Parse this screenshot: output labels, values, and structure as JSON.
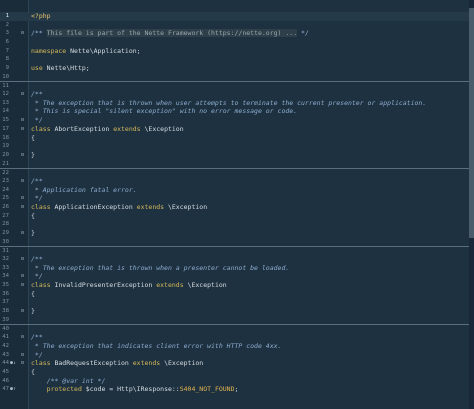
{
  "editor": {
    "lines": [
      {
        "n": "1",
        "tokens": [
          {
            "t": "<?php",
            "c": "tk-php"
          }
        ],
        "current": true
      },
      {
        "n": "2",
        "tokens": []
      },
      {
        "n": "3",
        "fold": "⊟",
        "tokens": [
          {
            "t": "/** ",
            "c": "tk-comment-plain"
          },
          {
            "t": "This file is part of the Nette Framework (https://nette.org) ...",
            "c": "hl"
          },
          {
            "t": " */",
            "c": "tk-comment-plain"
          }
        ]
      },
      {
        "n": "6",
        "tokens": []
      },
      {
        "n": "7",
        "tokens": [
          {
            "t": "namespace ",
            "c": "tk-keyword"
          },
          {
            "t": "Nette\\Application;",
            "c": "tk-text"
          }
        ]
      },
      {
        "n": "8",
        "tokens": []
      },
      {
        "n": "9",
        "tokens": [
          {
            "t": "use ",
            "c": "tk-keyword"
          },
          {
            "t": "Nette\\Http;",
            "c": "tk-text"
          }
        ]
      },
      {
        "n": "10",
        "tokens": []
      },
      {
        "n": "11",
        "tokens": [],
        "sep": true
      },
      {
        "n": "12",
        "fold": "⊟",
        "tokens": [
          {
            "t": "/**",
            "c": "tk-comment"
          }
        ]
      },
      {
        "n": "13",
        "tokens": [
          {
            "t": " * The exception that is thrown when user attempts to terminate the current presenter or application.",
            "c": "tk-comment"
          }
        ]
      },
      {
        "n": "14",
        "tokens": [
          {
            "t": " * This is special \"silent exception\" with no error message or code.",
            "c": "tk-comment"
          }
        ]
      },
      {
        "n": "15",
        "fold": "⊟",
        "tokens": [
          {
            "t": " */",
            "c": "tk-comment"
          }
        ]
      },
      {
        "n": "17",
        "fold": "⊟",
        "tokens": [
          {
            "t": "class ",
            "c": "tk-keyword"
          },
          {
            "t": "AbortException ",
            "c": "tk-text"
          },
          {
            "t": "extends ",
            "c": "tk-keyword"
          },
          {
            "t": "\\Exception",
            "c": "tk-text"
          }
        ]
      },
      {
        "n": "18",
        "tokens": [
          {
            "t": "{",
            "c": "tk-op"
          }
        ]
      },
      {
        "n": "19",
        "tokens": []
      },
      {
        "n": "20",
        "fold": "⊟",
        "tokens": [
          {
            "t": "}",
            "c": "tk-op"
          }
        ]
      },
      {
        "n": "21",
        "tokens": []
      },
      {
        "n": "22",
        "tokens": [],
        "sep": true
      },
      {
        "n": "23",
        "fold": "⊟",
        "tokens": [
          {
            "t": "/**",
            "c": "tk-comment"
          }
        ]
      },
      {
        "n": "24",
        "tokens": [
          {
            "t": " * Application fatal error.",
            "c": "tk-comment"
          }
        ]
      },
      {
        "n": "25",
        "fold": "⊟",
        "tokens": [
          {
            "t": " */",
            "c": "tk-comment"
          }
        ]
      },
      {
        "n": "26",
        "fold": "⊟",
        "tokens": [
          {
            "t": "class ",
            "c": "tk-keyword"
          },
          {
            "t": "ApplicationException ",
            "c": "tk-text"
          },
          {
            "t": "extends ",
            "c": "tk-keyword"
          },
          {
            "t": "\\Exception",
            "c": "tk-text"
          }
        ]
      },
      {
        "n": "27",
        "tokens": [
          {
            "t": "{",
            "c": "tk-op"
          }
        ]
      },
      {
        "n": "28",
        "tokens": []
      },
      {
        "n": "29",
        "fold": "⊟",
        "tokens": [
          {
            "t": "}",
            "c": "tk-op"
          }
        ]
      },
      {
        "n": "30",
        "tokens": []
      },
      {
        "n": "31",
        "tokens": [],
        "sep": true
      },
      {
        "n": "32",
        "fold": "⊟",
        "tokens": [
          {
            "t": "/**",
            "c": "tk-comment"
          }
        ]
      },
      {
        "n": "33",
        "tokens": [
          {
            "t": " * The exception that is thrown when a presenter cannot be loaded.",
            "c": "tk-comment"
          }
        ]
      },
      {
        "n": "34",
        "fold": "⊟",
        "tokens": [
          {
            "t": " */",
            "c": "tk-comment"
          }
        ]
      },
      {
        "n": "35",
        "fold": "⊟",
        "tokens": [
          {
            "t": "class ",
            "c": "tk-keyword"
          },
          {
            "t": "InvalidPresenterException ",
            "c": "tk-text"
          },
          {
            "t": "extends ",
            "c": "tk-keyword"
          },
          {
            "t": "\\Exception",
            "c": "tk-text"
          }
        ]
      },
      {
        "n": "36",
        "tokens": [
          {
            "t": "{",
            "c": "tk-op"
          }
        ]
      },
      {
        "n": "37",
        "tokens": []
      },
      {
        "n": "38",
        "fold": "⊟",
        "tokens": [
          {
            "t": "}",
            "c": "tk-op"
          }
        ]
      },
      {
        "n": "39",
        "tokens": []
      },
      {
        "n": "40",
        "tokens": [],
        "sep": true
      },
      {
        "n": "41",
        "fold": "⊟",
        "tokens": [
          {
            "t": "/**",
            "c": "tk-comment"
          }
        ]
      },
      {
        "n": "42",
        "tokens": [
          {
            "t": " * The exception that indicates client error with HTTP code 4xx.",
            "c": "tk-comment"
          }
        ]
      },
      {
        "n": "43",
        "fold": "⊟",
        "tokens": [
          {
            "t": " */",
            "c": "tk-comment"
          }
        ]
      },
      {
        "n": "44",
        "marker": "●↓",
        "fold": "⊟",
        "tokens": [
          {
            "t": "class ",
            "c": "tk-keyword"
          },
          {
            "t": "BadRequestException ",
            "c": "tk-text"
          },
          {
            "t": "extends ",
            "c": "tk-keyword"
          },
          {
            "t": "\\Exception",
            "c": "tk-text"
          }
        ]
      },
      {
        "n": "45",
        "tokens": [
          {
            "t": "{",
            "c": "tk-op"
          }
        ]
      },
      {
        "n": "46",
        "tokens": [
          {
            "t": "    /** ",
            "c": "tk-comment"
          },
          {
            "t": "@var int",
            "c": "tk-comment"
          },
          {
            "t": " */",
            "c": "tk-comment"
          }
        ]
      },
      {
        "n": "47",
        "marker": "●↑",
        "tokens": [
          {
            "t": "    protected ",
            "c": "tk-keyword"
          },
          {
            "t": "$code = Http\\IResponse::",
            "c": "tk-text"
          },
          {
            "t": "S404_NOT_FOUND",
            "c": "tk-constant"
          },
          {
            "t": ";",
            "c": "tk-text"
          }
        ]
      }
    ]
  }
}
